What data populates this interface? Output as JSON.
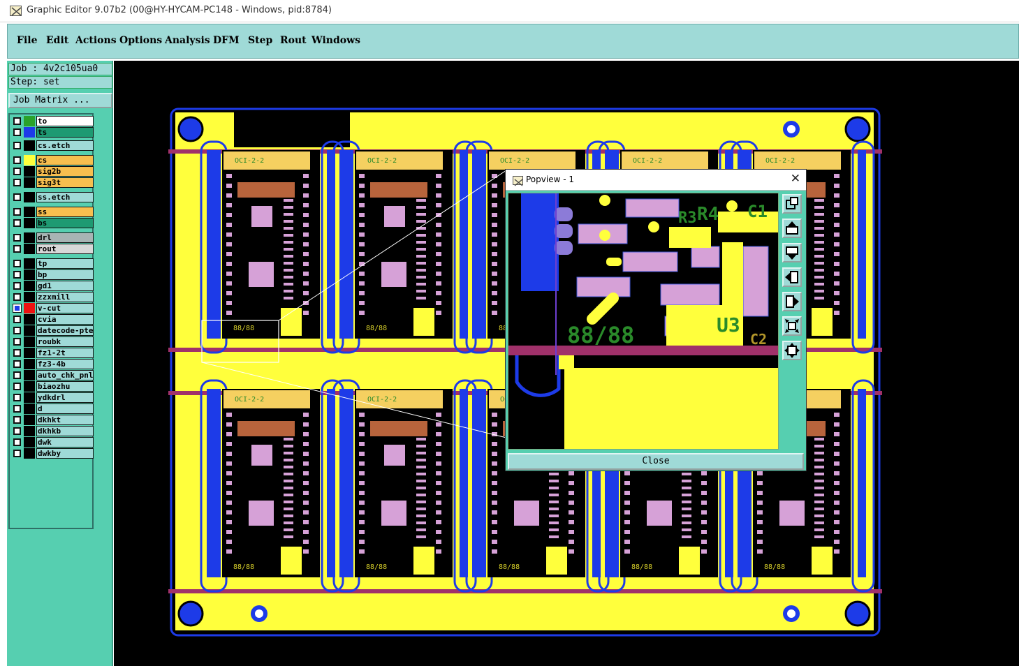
{
  "window": {
    "title": "Graphic Editor 9.07b2 (00@HY-HYCAM-PC148 - Windows, pid:8784)"
  },
  "menu": [
    {
      "label": "File"
    },
    {
      "label": "Edit"
    },
    {
      "label": "Actions"
    },
    {
      "label": "Options"
    },
    {
      "label": "Analysis"
    },
    {
      "label": "DFM"
    },
    {
      "label": "Step"
    },
    {
      "label": "Rout"
    },
    {
      "label": "Windows"
    }
  ],
  "job": {
    "job_label": "Job : 4v2c105ua0",
    "step_label": "Step: set",
    "matrix_button": "Job Matrix ..."
  },
  "layers": [
    {
      "name": "to",
      "color": "#2aa22a",
      "bg": "#ffffff",
      "checked": false
    },
    {
      "name": "ts",
      "color": "#1d3be8",
      "bg": "#1e9a72",
      "checked": false
    },
    {
      "name": "cs.etch",
      "color": "#000000",
      "bg": "#9fdad7",
      "checked": false
    },
    {
      "name": "cs",
      "color": "#ffff3c",
      "bg": "#f7bf4f",
      "checked": false
    },
    {
      "name": "sig2b",
      "color": "#000000",
      "bg": "#f7bf4f",
      "checked": false
    },
    {
      "name": "sig3t",
      "color": "#000000",
      "bg": "#f7bf4f",
      "checked": false
    },
    {
      "name": "ss.etch",
      "color": "#000000",
      "bg": "#9fdad7",
      "checked": false
    },
    {
      "name": "ss",
      "color": "#000000",
      "bg": "#f7bf4f",
      "checked": false
    },
    {
      "name": "bs",
      "color": "#000000",
      "bg": "#1e9a72",
      "checked": false
    },
    {
      "name": "drl",
      "color": "#000000",
      "bg": "#a8b4b4",
      "checked": false
    },
    {
      "name": "rout",
      "color": "#000000",
      "bg": "#d8d8d8",
      "checked": false
    },
    {
      "name": "tp",
      "color": "#000000",
      "bg": "#9fdad7",
      "checked": false
    },
    {
      "name": "bp",
      "color": "#000000",
      "bg": "#9fdad7",
      "checked": false
    },
    {
      "name": "gd1",
      "color": "#000000",
      "bg": "#9fdad7",
      "checked": false
    },
    {
      "name": "zzxmill",
      "color": "#000000",
      "bg": "#9fdad7",
      "checked": false
    },
    {
      "name": "v-cut",
      "color": "#ee1111",
      "bg": "#9fdad7",
      "checked": true
    },
    {
      "name": "cvia",
      "color": "#000000",
      "bg": "#9fdad7",
      "checked": false
    },
    {
      "name": "datecode-pte",
      "color": "#000000",
      "bg": "#9fdad7",
      "checked": false
    },
    {
      "name": "roubk",
      "color": "#000000",
      "bg": "#9fdad7",
      "checked": false
    },
    {
      "name": "fz1-2t",
      "color": "#000000",
      "bg": "#9fdad7",
      "checked": false
    },
    {
      "name": "fz3-4b",
      "color": "#000000",
      "bg": "#9fdad7",
      "checked": false
    },
    {
      "name": "auto_chk_pnl",
      "color": "#000000",
      "bg": "#9fdad7",
      "checked": false
    },
    {
      "name": "biaozhu",
      "color": "#000000",
      "bg": "#9fdad7",
      "checked": false
    },
    {
      "name": "ydkdrl",
      "color": "#000000",
      "bg": "#9fdad7",
      "checked": false
    },
    {
      "name": "d",
      "color": "#000000",
      "bg": "#9fdad7",
      "checked": false
    },
    {
      "name": "dkhkt",
      "color": "#000000",
      "bg": "#9fdad7",
      "checked": false
    },
    {
      "name": "dkhkb",
      "color": "#000000",
      "bg": "#9fdad7",
      "checked": false
    },
    {
      "name": "dwk",
      "color": "#000000",
      "bg": "#9fdad7",
      "checked": false
    },
    {
      "name": "dwkby",
      "color": "#000000",
      "bg": "#9fdad7",
      "checked": false
    }
  ],
  "board": {
    "unit_label": "OCI-2-2",
    "datecode": "88/88"
  },
  "popview": {
    "title": "Popview - 1",
    "close_label": "Close",
    "zoom_labels": [
      "R3",
      "R4",
      "C1",
      "U3",
      "C2",
      "88/88"
    ]
  },
  "colors": {
    "background": "#000000",
    "copper": "#ffff3c",
    "soldermask": "#1d3be8",
    "pads": "#d6a1d7",
    "vcut": "#a0316a",
    "silkscreen": "#2a8a2a",
    "panel_ui": "#56cfb0"
  }
}
